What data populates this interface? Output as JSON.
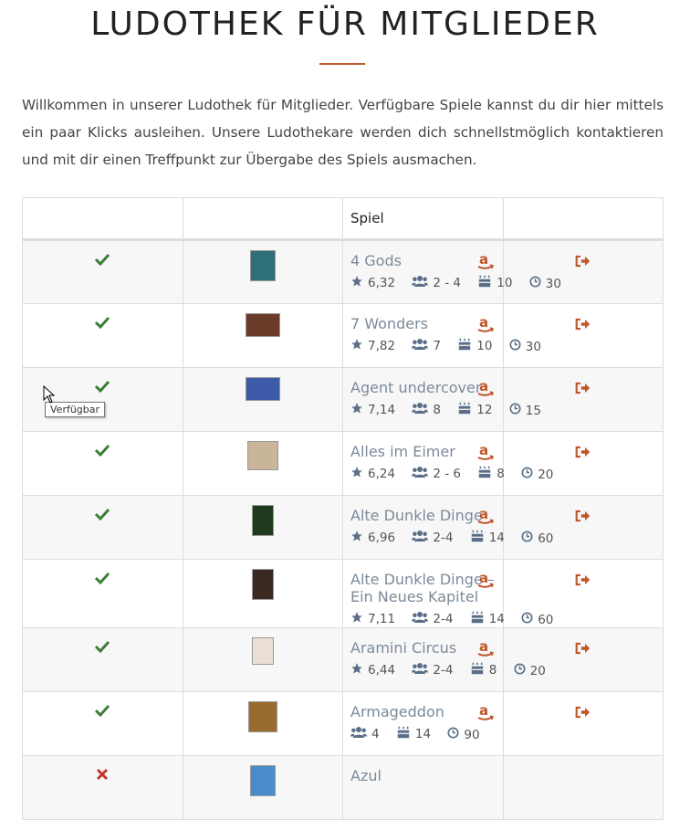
{
  "page": {
    "title": "LUDOTHEK FÜR MITGLIEDER",
    "intro": "Willkommen in unserer Ludothek für Mitglieder. Verfügbare Spiele kannst du dir hier mittels ein paar Klicks ausleihen. Unsere Ludothekare werden dich schnellstmöglich kontaktieren und mit dir einen Treffpunkt zur Übergabe des Spiels ausmachen."
  },
  "table": {
    "col_game": "Spiel",
    "rows": [
      {
        "name": "4 Gods",
        "available": true,
        "rating": "6,32",
        "players": "2 - 4",
        "age": "10",
        "time": "30",
        "box_color": "#2e6f78",
        "box_w": 28,
        "box_h": 34
      },
      {
        "name": "7 Wonders",
        "available": true,
        "rating": "7,82",
        "players": "7",
        "age": "10",
        "time": "30",
        "box_color": "#6b3b2a",
        "box_w": 38,
        "box_h": 26
      },
      {
        "name": "Agent undercover",
        "available": true,
        "rating": "7,14",
        "players": "8",
        "age": "12",
        "time": "15",
        "box_color": "#3d5aa8",
        "box_w": 38,
        "box_h": 26
      },
      {
        "name": "Alles im Eimer",
        "available": true,
        "rating": "6,24",
        "players": "2 - 6",
        "age": "8",
        "time": "20",
        "box_color": "#c9b59a",
        "box_w": 34,
        "box_h": 32
      },
      {
        "name": "Alte Dunkle Dinge",
        "available": true,
        "rating": "6,96",
        "players": "2-4",
        "age": "14",
        "time": "60",
        "box_color": "#1f3a1c",
        "box_w": 24,
        "box_h": 34
      },
      {
        "name": "Alte Dunkle Dinge – Ein Neues Kapitel",
        "available": true,
        "rating": "7,11",
        "players": "2-4",
        "age": "14",
        "time": "60",
        "box_color": "#3a2a22",
        "box_w": 24,
        "box_h": 34
      },
      {
        "name": "Aramini Circus",
        "available": true,
        "rating": "6,44",
        "players": "2-4",
        "age": "8",
        "time": "20",
        "box_color": "#e9dfd4",
        "box_w": 24,
        "box_h": 30
      },
      {
        "name": "Armageddon",
        "available": true,
        "rating": "",
        "players": "4",
        "age": "14",
        "time": "90",
        "box_color": "#9a6b2e",
        "box_w": 32,
        "box_h": 34
      },
      {
        "name": "Azul",
        "available": false,
        "rating": "",
        "players": "",
        "age": "",
        "time": "",
        "box_color": "#4a8cc9",
        "box_w": 28,
        "box_h": 34
      }
    ]
  },
  "tooltip": "Verfügbar",
  "colors": {
    "accent": "#c0562b",
    "check": "#3f7d3a",
    "cross": "#c0392b",
    "game_link": "#7b8a99",
    "amazon": "#c0562b"
  },
  "icons": {
    "available": "check-icon",
    "unavailable": "cross-icon",
    "rating": "star-icon",
    "players": "users-icon",
    "age": "birthday-cake-icon",
    "time": "clock-icon",
    "amazon": "amazon-icon",
    "lend": "sign-out-icon"
  }
}
